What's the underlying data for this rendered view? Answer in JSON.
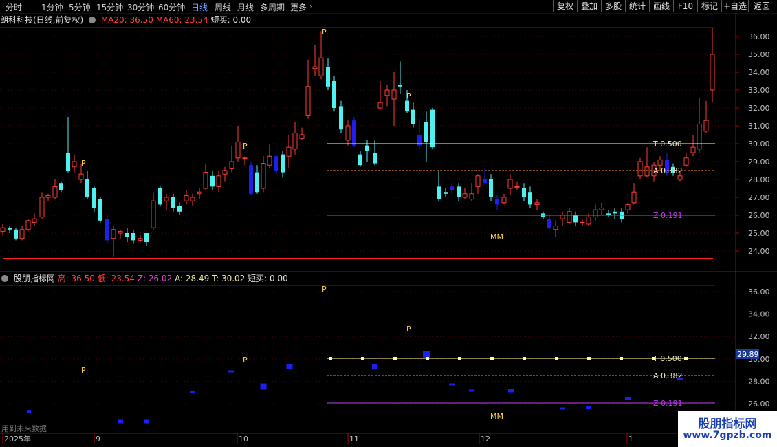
{
  "toolbar": {
    "tabs": [
      "分时",
      "1分钟",
      "5分钟",
      "15分钟",
      "30分钟",
      "60分钟",
      "日线",
      "周线",
      "月线",
      "多周期",
      "更多"
    ],
    "active_tab": "日线",
    "right_buttons": [
      "复权",
      "叠加",
      "多股",
      "统计",
      "画线",
      "F10",
      "标记",
      "+自选",
      "返回"
    ]
  },
  "main_panel": {
    "stock_title": "朗科科技(日线,前复权)",
    "ma20": "MA20: 36.50",
    "ma60": "MA60: 23.54",
    "short_buy": "短买: 0.00",
    "price_axis": [
      "36.00",
      "35.00",
      "34.00",
      "33.00",
      "32.00",
      "31.00",
      "30.00",
      "29.00",
      "28.00",
      "27.00",
      "26.00",
      "25.00",
      "24.00"
    ],
    "fib_labels": {
      "t": "T 0.500",
      "a": "A 0.382",
      "z": "Z 0.191"
    },
    "mm_label": "MM",
    "p_label": "P"
  },
  "indicator_panel": {
    "name": "股朋指标网",
    "high": "高: 36.50",
    "low": "低: 23.54",
    "z": "Z: 26.02",
    "a": "A: 28.49",
    "t": "T: 30.02",
    "short_buy": "短买: 0.00",
    "price_axis": [
      "36.00",
      "34.00",
      "32.00",
      "30.00",
      "28.00",
      "26.00"
    ],
    "current_price": "29.89",
    "fib_labels": {
      "t": "T 0.500",
      "a": "A 0.382",
      "z": "Z 0.191"
    },
    "mm_label": "MM",
    "p_label": "P",
    "footer_note": "用到未来数据"
  },
  "time_axis": [
    "2025年",
    "9",
    "10",
    "11",
    "12",
    "1"
  ],
  "watermark": {
    "name": "股朋指标网",
    "url": "www.7gpzb.com"
  },
  "colors": {
    "up": "#ff3c3c",
    "down": "#4ff0f0",
    "strong_down": "#1e1ef0",
    "t_line": "#ffff99",
    "a_line": "#ff8c1a",
    "z_line": "#c03cf0",
    "p_text": "#ffd84a",
    "grid": "#5a0000",
    "axis": "#b00000"
  },
  "chart_data": {
    "type": "candlestick",
    "x": [
      "2025年",
      "9",
      "10",
      "11",
      "12",
      "1"
    ],
    "ylim": [
      23.5,
      36.5
    ],
    "high": 36.5,
    "low": 23.54,
    "levels": {
      "T": 30.02,
      "A": 28.49,
      "Z": 26.02
    },
    "current": 29.89
  }
}
